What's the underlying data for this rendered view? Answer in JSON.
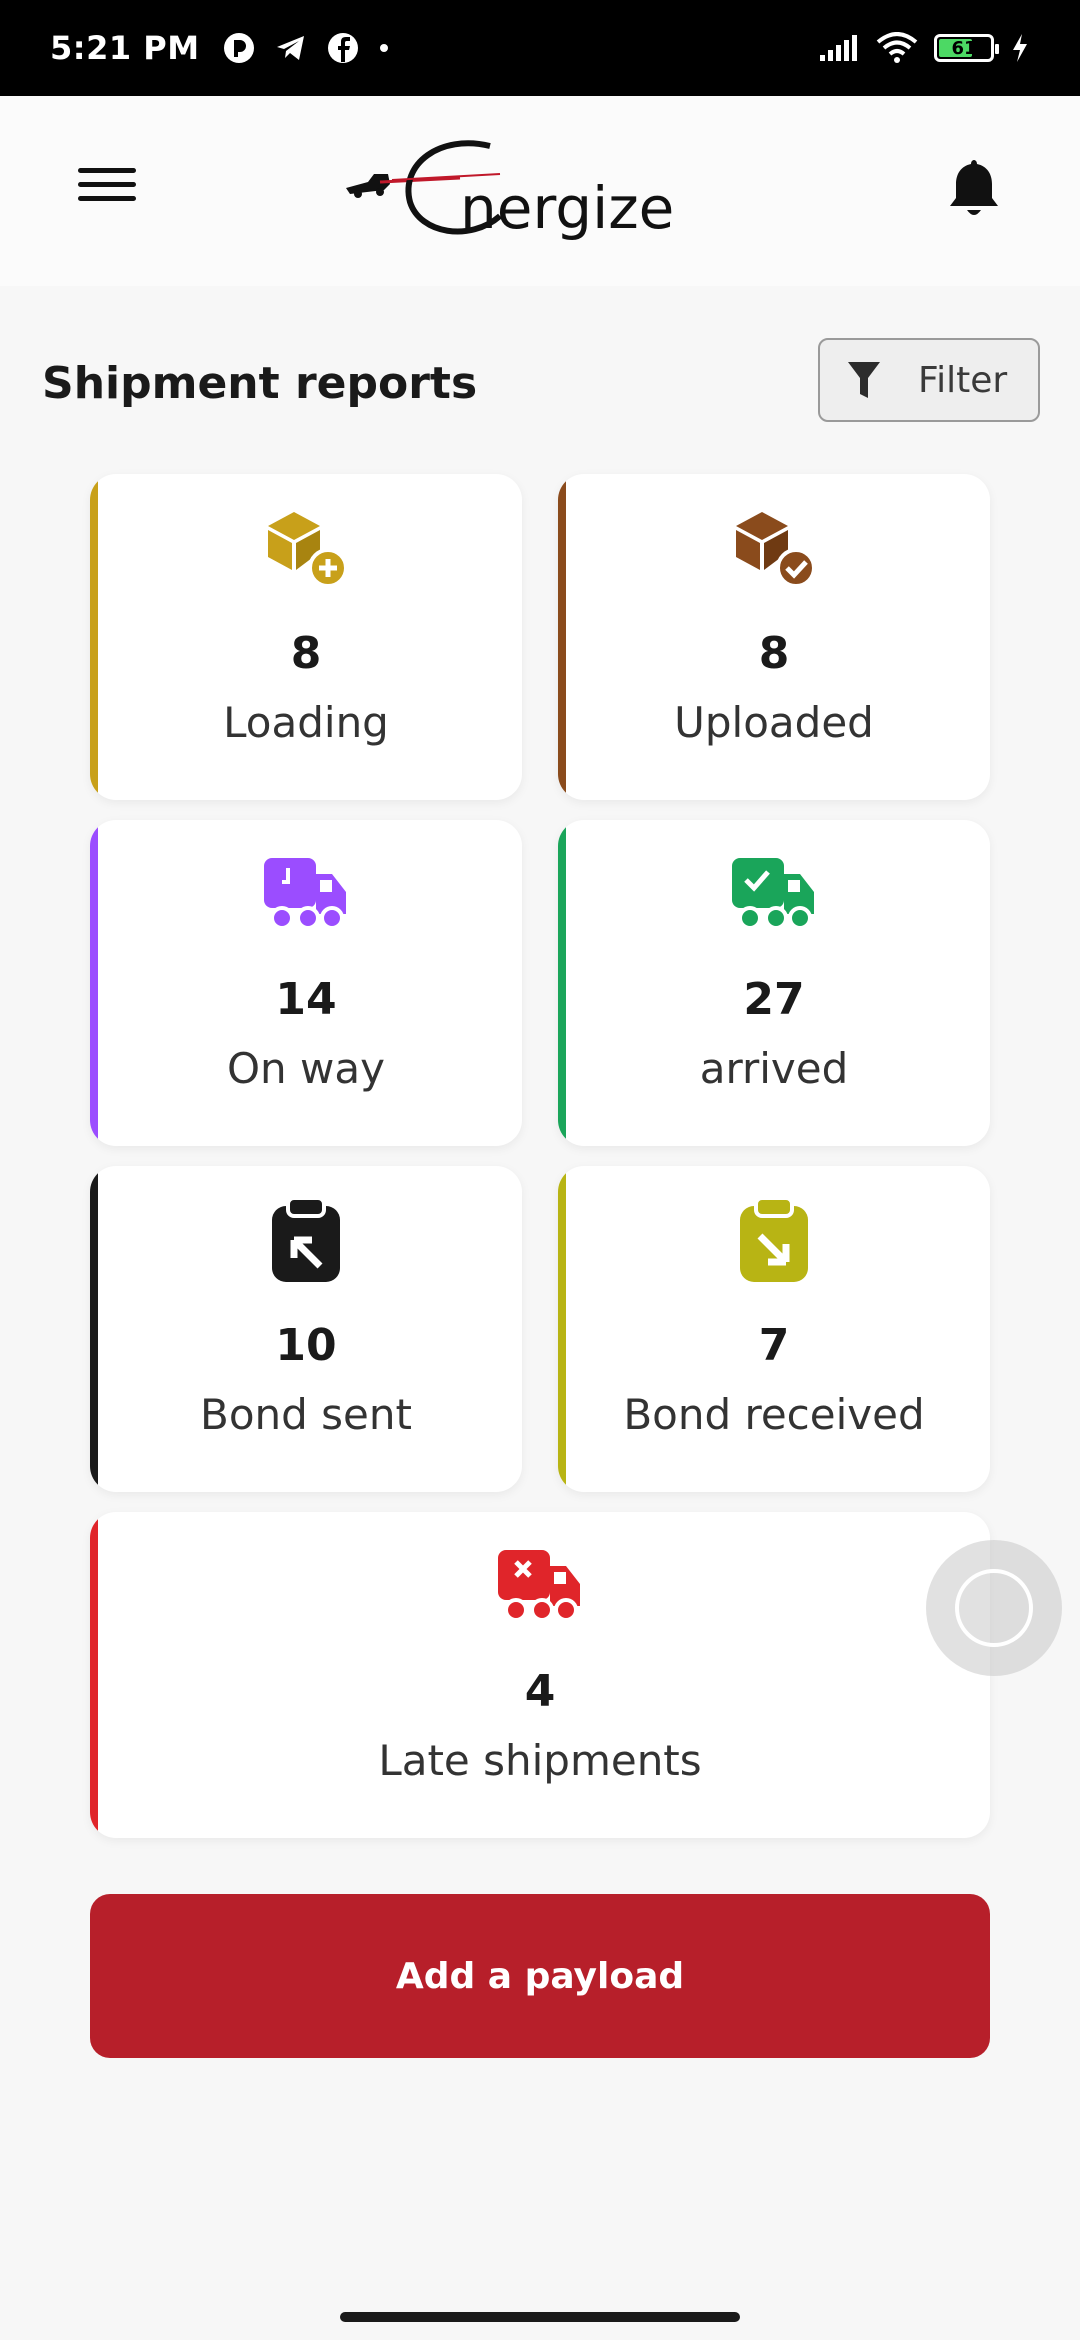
{
  "status_bar": {
    "time": "5:21 PM",
    "battery_level": "61",
    "icons": [
      "app-icon",
      "telegram-icon",
      "facebook-icon",
      "dot-icon",
      "signal-icon",
      "wifi-icon",
      "battery-icon",
      "charging-icon"
    ]
  },
  "header": {
    "logo_text": "Energize",
    "menu_icon": "hamburger-menu-icon",
    "notification_icon": "bell-icon"
  },
  "section": {
    "title": "Shipment reports",
    "filter_label": "Filter"
  },
  "cards": [
    {
      "count": "8",
      "label": "Loading",
      "color": "#c8a01a",
      "icon": "box-plus-icon"
    },
    {
      "count": "8",
      "label": "Uploaded",
      "color": "#8a4b1c",
      "icon": "box-check-icon"
    },
    {
      "count": "14",
      "label": "On way",
      "color": "#9b4dff",
      "icon": "truck-clock-icon"
    },
    {
      "count": "27",
      "label": "arrived",
      "color": "#1aa55a",
      "icon": "truck-check-icon"
    },
    {
      "count": "10",
      "label": "Bond sent",
      "color": "#1a1a1a",
      "icon": "clipboard-arrow-out-icon"
    },
    {
      "count": "7",
      "label": "Bond received",
      "color": "#b8b414",
      "icon": "clipboard-arrow-in-icon"
    },
    {
      "count": "4",
      "label": "Late shipments",
      "color": "#e0252a",
      "icon": "truck-x-icon"
    }
  ],
  "actions": {
    "add_payload_label": "Add a payload"
  }
}
